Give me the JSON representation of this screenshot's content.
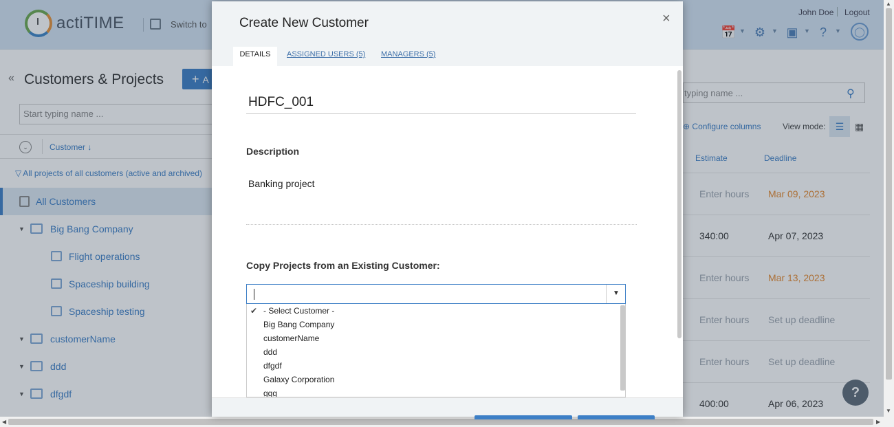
{
  "app": {
    "logo_text": "actiTIME",
    "switch_label": "Switch to",
    "user_name": "John Doe",
    "logout_label": "Logout"
  },
  "left_panel": {
    "title": "Customers & Projects",
    "add_label": "A",
    "search_placeholder": "Start typing name ...",
    "sort_label": "Customer ↓",
    "filter_label": "All projects of all customers (active and archived)",
    "tree": [
      {
        "label": "All Customers",
        "level": 0,
        "selected": true
      },
      {
        "label": "Big Bang Company",
        "level": 0
      },
      {
        "label": "Flight operations",
        "level": 1
      },
      {
        "label": "Spaceship building",
        "level": 1
      },
      {
        "label": "Spaceship testing",
        "level": 1
      },
      {
        "label": "customerName",
        "level": 0
      },
      {
        "label": "ddd",
        "level": 0
      },
      {
        "label": "dfgdf",
        "level": 0
      }
    ]
  },
  "right_panel": {
    "search_placeholder": "typing name ...",
    "configure_columns": "Configure columns",
    "view_mode_label": "View mode:",
    "columns": [
      "Estimate",
      "Deadline"
    ],
    "rows": [
      {
        "estimate": "Enter hours",
        "deadline": "Mar 09, 2023",
        "deadline_status": "overdue"
      },
      {
        "estimate": "340:00",
        "deadline": "Apr 07, 2023",
        "deadline_status": "normal"
      },
      {
        "estimate": "Enter hours",
        "deadline": "Mar 13, 2023",
        "deadline_status": "overdue"
      },
      {
        "estimate": "Enter hours",
        "deadline": "Set up deadline",
        "deadline_status": "placeholder"
      },
      {
        "estimate": "Enter hours",
        "deadline": "Set up deadline",
        "deadline_status": "placeholder"
      },
      {
        "estimate": "400:00",
        "deadline": "Apr 06, 2023",
        "deadline_status": "normal"
      }
    ]
  },
  "modal": {
    "title": "Create New Customer",
    "close_label": "×",
    "tabs": [
      {
        "label": "DETAILS",
        "active": true
      },
      {
        "label": "ASSIGNED USERS (5)",
        "active": false
      },
      {
        "label": "MANAGERS (5)",
        "active": false
      }
    ],
    "customer_name": "HDFC_001",
    "description_label": "Description",
    "description_value": "Banking project",
    "copy_label": "Copy Projects from an Existing Customer:",
    "copy_input_value": "",
    "dropdown_options": [
      "- Select Customer -",
      "Big Bang Company",
      "customerName",
      "ddd",
      "dfgdf",
      "Galaxy Corporation",
      "ggg"
    ],
    "dropdown_selected": "- Select Customer -"
  },
  "colors": {
    "accent": "#3d7fc6",
    "overdue": "#e6892f",
    "topbar": "#d4e4f4"
  }
}
